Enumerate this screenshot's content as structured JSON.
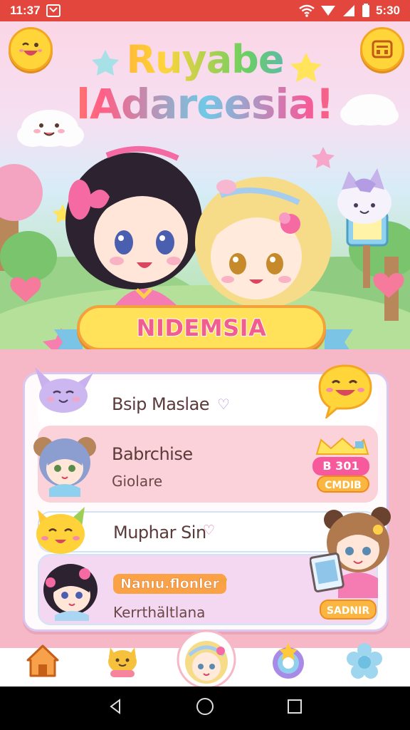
{
  "status_bar": {
    "time_left": "11:37",
    "time_right": "5:30"
  },
  "header": {
    "title_line_1": "Ruyabe",
    "title_line_2": "lAdareesia!"
  },
  "banner": {
    "label": "NIDEMSIA"
  },
  "list": {
    "row1": {
      "title": "Bsip Maslae"
    },
    "row2": {
      "title": "Babrchise",
      "subtitle": "Giolare",
      "badge_top": "B 301",
      "badge_bottom": "CMDIB"
    },
    "row3": {
      "title": "Muphar Sin"
    },
    "row4": {
      "name_badge": "Nanıu.flonler",
      "subtitle": "Kerrthältlana",
      "button": "SADNIR"
    }
  },
  "colors": {
    "status_bar": "#e3463c",
    "accent_yellow": "#ffd53a",
    "accent_pink": "#f25d8f",
    "panel_pink": "#f6b8c6"
  },
  "icons": {
    "left_top": "smiley-emoji-icon",
    "right_top": "menu-icon",
    "nav": [
      "home-icon",
      "cat-icon",
      "profile-avatar-icon",
      "target-icon",
      "flower-icon"
    ]
  }
}
